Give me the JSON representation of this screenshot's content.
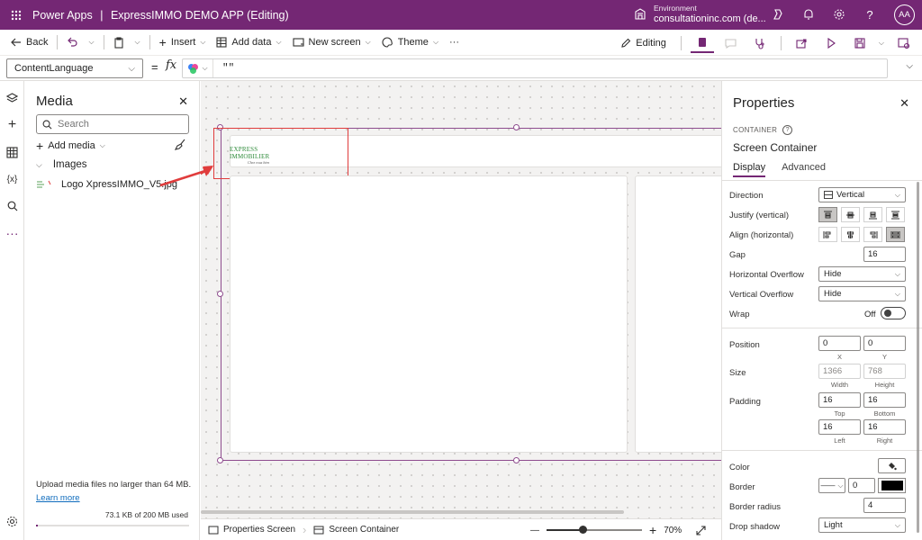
{
  "titlebar": {
    "product": "Power Apps",
    "separator": "|",
    "app_name": "ExpressIMMO DEMO APP (Editing)",
    "environment_label": "Environment",
    "environment_name": "consultationinc.com (de...",
    "avatar_initials": "AA",
    "background_color": "#742774"
  },
  "cmdbar": {
    "back": "Back",
    "insert": "Insert",
    "add_data": "Add data",
    "new_screen": "New screen",
    "theme": "Theme",
    "more": "···",
    "editing": "Editing"
  },
  "formula": {
    "property": "ContentLanguage",
    "equals": "=",
    "fx": "fx",
    "value": "\"\""
  },
  "media": {
    "title": "Media",
    "search_placeholder": "Search",
    "add_media": "Add media",
    "group": "Images",
    "file": "Logo XpressIMMO_V5.jpg",
    "upload_note": "Upload media files no larger than 64 MB.",
    "learn_more": "Learn more",
    "storage": "73.1 KB of 200 MB used",
    "storage_fraction": 0.0004
  },
  "canvas": {
    "logo_line1": "EXPRESS",
    "logo_line2": "IMMOBILIER",
    "logo_tagline": "Chez vous bien",
    "zoom": "70%",
    "zoom_fraction": 0.38
  },
  "statusbar": {
    "crumb1": "Properties Screen",
    "crumb2": "Screen Container",
    "minus": "—",
    "plus": "+"
  },
  "props": {
    "title": "Properties",
    "type_label": "CONTAINER",
    "control_name": "Screen Container",
    "tab_display": "Display",
    "tab_advanced": "Advanced",
    "direction_label": "Direction",
    "direction_value": "Vertical",
    "justify_label": "Justify (vertical)",
    "align_label": "Align (horizontal)",
    "gap_label": "Gap",
    "gap_value": "16",
    "h_overflow_label": "Horizontal Overflow",
    "h_overflow_value": "Hide",
    "v_overflow_label": "Vertical Overflow",
    "v_overflow_value": "Hide",
    "wrap_label": "Wrap",
    "wrap_value": "Off",
    "position_label": "Position",
    "pos_x": "0",
    "pos_y": "0",
    "x_label": "X",
    "y_label": "Y",
    "size_label": "Size",
    "width": "1366",
    "height": "768",
    "width_label": "Width",
    "height_label": "Height",
    "padding_label": "Padding",
    "pad_top": "16",
    "pad_bottom": "16",
    "pad_left": "16",
    "pad_right": "16",
    "top_label": "Top",
    "bottom_label": "Bottom",
    "left_label": "Left",
    "right_label": "Right",
    "color_label": "Color",
    "border_label": "Border",
    "border_value": "0",
    "border_color": "#000000",
    "border_radius_label": "Border radius",
    "border_radius_value": "4",
    "shadow_label": "Drop shadow",
    "shadow_value": "Light"
  }
}
